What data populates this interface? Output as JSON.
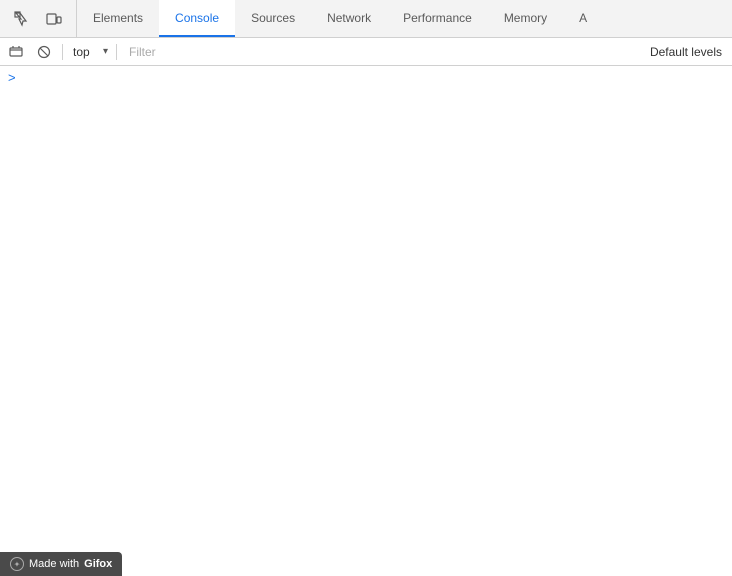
{
  "tabs": [
    {
      "id": "elements",
      "label": "Elements",
      "active": false
    },
    {
      "id": "console",
      "label": "Console",
      "active": true
    },
    {
      "id": "sources",
      "label": "Sources",
      "active": false
    },
    {
      "id": "network",
      "label": "Network",
      "active": false
    },
    {
      "id": "performance",
      "label": "Performance",
      "active": false
    },
    {
      "id": "memory",
      "label": "Memory",
      "active": false
    },
    {
      "id": "more",
      "label": "A",
      "active": false
    }
  ],
  "toolbar": {
    "context_value": "top",
    "filter_placeholder": "Filter",
    "default_levels_label": "Default levels"
  },
  "console": {
    "prompt_symbol": ">"
  },
  "badge": {
    "prefix": "Made with",
    "app": "Gifox"
  }
}
